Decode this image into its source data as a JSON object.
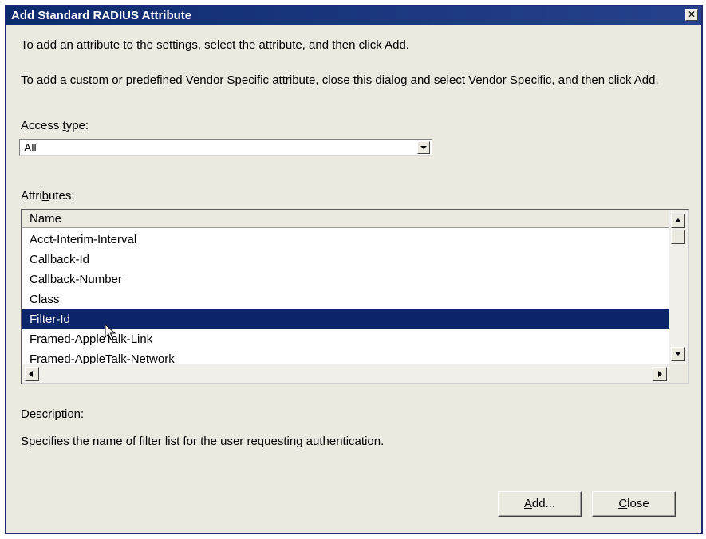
{
  "window": {
    "title": "Add Standard RADIUS Attribute",
    "close_glyph": "✕"
  },
  "instructions": {
    "line1": "To add an attribute to the settings, select the attribute, and then click Add.",
    "line2": "To add a custom or predefined Vendor Specific attribute, close this dialog and select Vendor Specific, and then click Add."
  },
  "access_type": {
    "label_pre": "Access ",
    "label_accel": "t",
    "label_post": "ype:",
    "selected": "All"
  },
  "attributes": {
    "label_pre": "Attri",
    "label_accel": "b",
    "label_post": "utes:",
    "column_header": "Name",
    "rows": [
      "Acct-Interim-Interval",
      "Callback-Id",
      "Callback-Number",
      "Class",
      "Filter-Id",
      "Framed-AppleTalk-Link",
      "Framed-AppleTalk-Network"
    ],
    "selected_row": "Filter-Id"
  },
  "description": {
    "label": "Description:",
    "text": "Specifies the name of filter list for the user requesting authentication."
  },
  "buttons": {
    "add_accel": "A",
    "add_rest": "dd...",
    "close_accel": "C",
    "close_rest": "lose"
  },
  "colors": {
    "titlebar": "#0e2a6f",
    "selection": "#0c246a",
    "dialog_bg": "#ece9e1"
  },
  "icons": {
    "cursor": "arrow-pointer-icon",
    "close": "close-icon"
  }
}
